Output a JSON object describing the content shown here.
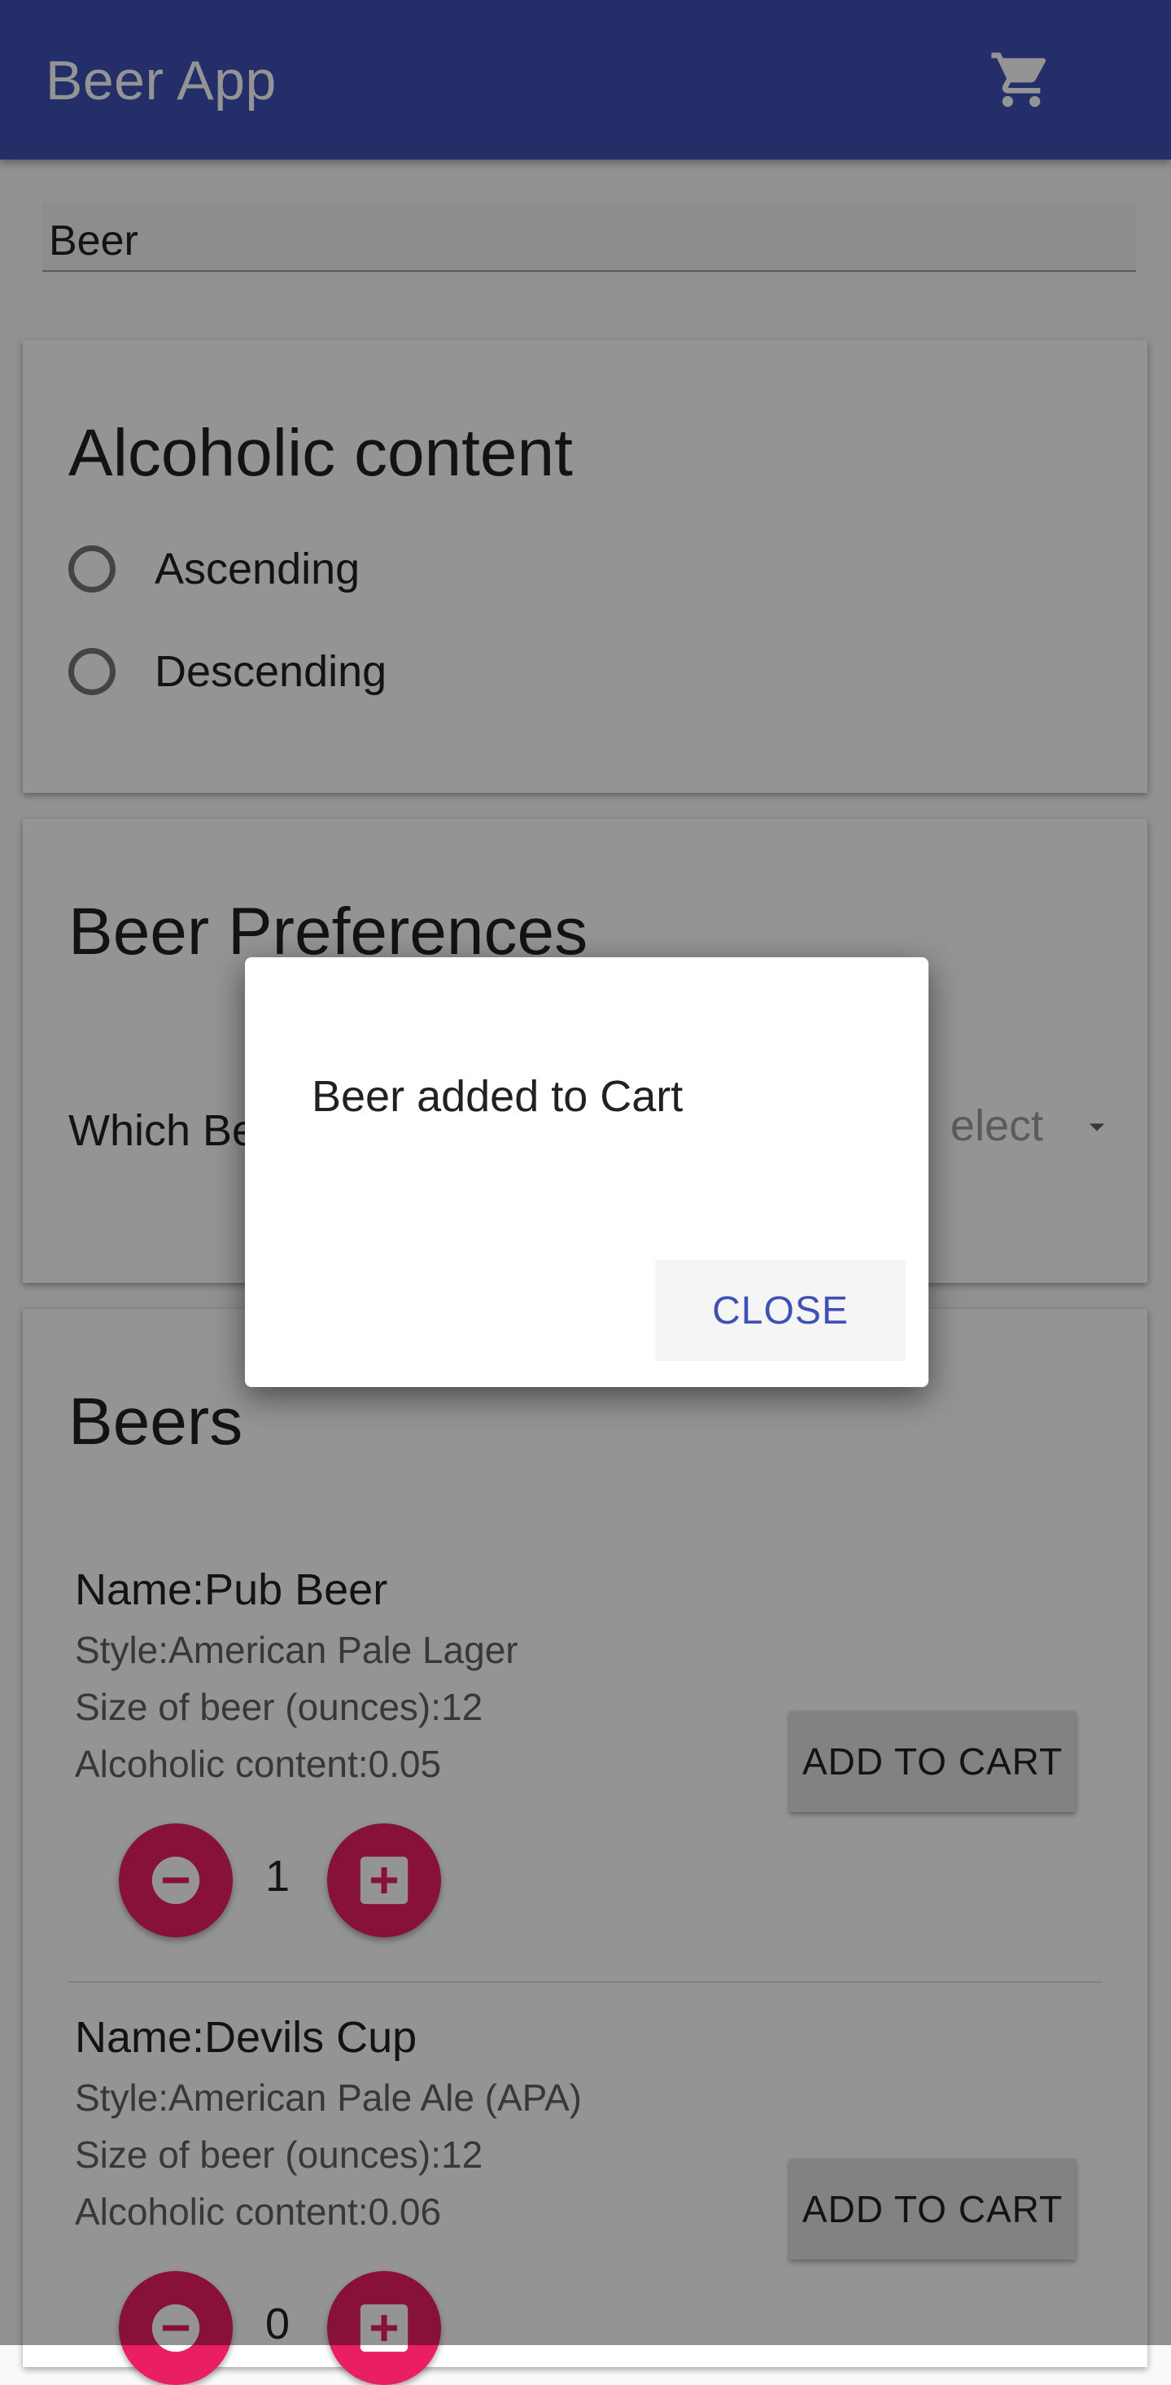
{
  "appbar": {
    "title": "Beer App",
    "cart_icon": "shopping-cart-icon"
  },
  "search": {
    "value": "Beer"
  },
  "sort_card": {
    "title": "Alcoholic content",
    "options": [
      "Ascending",
      "Descending"
    ]
  },
  "prefs_card": {
    "title": "Beer Preferences",
    "label": "Which Be",
    "select_placeholder": "elect"
  },
  "beers_card": {
    "title": "Beers",
    "add_to_cart_label": "ADD TO CART",
    "items": [
      {
        "name": "Name:Pub Beer",
        "style": "Style:American Pale Lager",
        "size": "Size of beer (ounces):12",
        "alcohol": "Alcoholic content:0.05",
        "quantity": "1"
      },
      {
        "name": "Name:Devils Cup",
        "style": "Style:American Pale Ale (APA)",
        "size": "Size of beer (ounces):12",
        "alcohol": "Alcoholic content:0.06",
        "quantity": "0"
      }
    ]
  },
  "dialog": {
    "message": "Beer added to Cart",
    "close_label": "CLOSE"
  },
  "colors": {
    "primary": "#3f51b5",
    "accent": "#e91e63"
  }
}
